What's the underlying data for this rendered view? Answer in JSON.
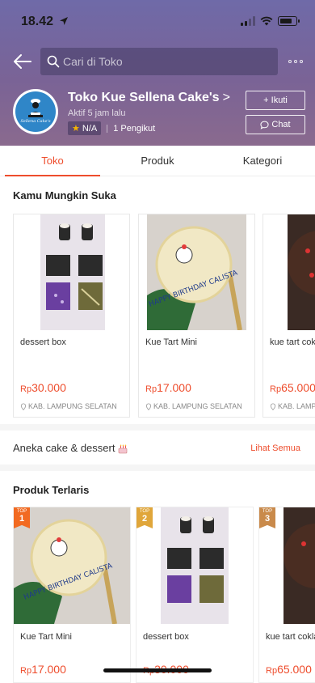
{
  "status_bar": {
    "time": "18.42"
  },
  "search": {
    "placeholder": "Cari di Toko"
  },
  "shop": {
    "name": "Toko Kue Sellena Cake's",
    "name_chevron": ">",
    "active": "Aktif 5 jam lalu",
    "rating": "N/A",
    "followers": "1 Pengikut",
    "avatar_caption": "Sellena Cake's",
    "follow_label": "+ Ikuti",
    "chat_label": "Chat"
  },
  "tabs": [
    {
      "label": "Toko",
      "active": true
    },
    {
      "label": "Produk",
      "active": false
    },
    {
      "label": "Kategori",
      "active": false
    }
  ],
  "recommended": {
    "title": "Kamu Mungkin Suka",
    "items": [
      {
        "name": "dessert box",
        "currency": "Rp",
        "price": "30.000",
        "location": "KAB. LAMPUNG SELATAN"
      },
      {
        "name": "Kue Tart Mini",
        "currency": "Rp",
        "price": "17.000",
        "location": "KAB. LAMPUNG SELATAN"
      },
      {
        "name": "kue tart coklat",
        "currency": "Rp",
        "price": "65.000",
        "location": "KAB. LAMPUNG SELATAN"
      }
    ]
  },
  "aneka": {
    "title": "Aneka cake & dessert",
    "link": "Lihat Semua"
  },
  "bestsellers": {
    "title": "Produk Terlaris",
    "badge_label": "TOP",
    "items": [
      {
        "rank": "1",
        "name": "Kue Tart Mini",
        "currency": "Rp",
        "price": "17.000",
        "badge_color": "#f26a21"
      },
      {
        "rank": "2",
        "name": "dessert box",
        "currency": "Rp",
        "price": "30.000",
        "badge_color": "#e0a63a"
      },
      {
        "rank": "3",
        "name": "kue tart coklat",
        "currency": "Rp",
        "price": "65.000",
        "badge_color": "#c98a4b"
      }
    ]
  },
  "colors": {
    "accent": "#ee4d2d",
    "header": "#74689e"
  },
  "cake_text": "HAPPY BIRTHDAY CALISTA"
}
